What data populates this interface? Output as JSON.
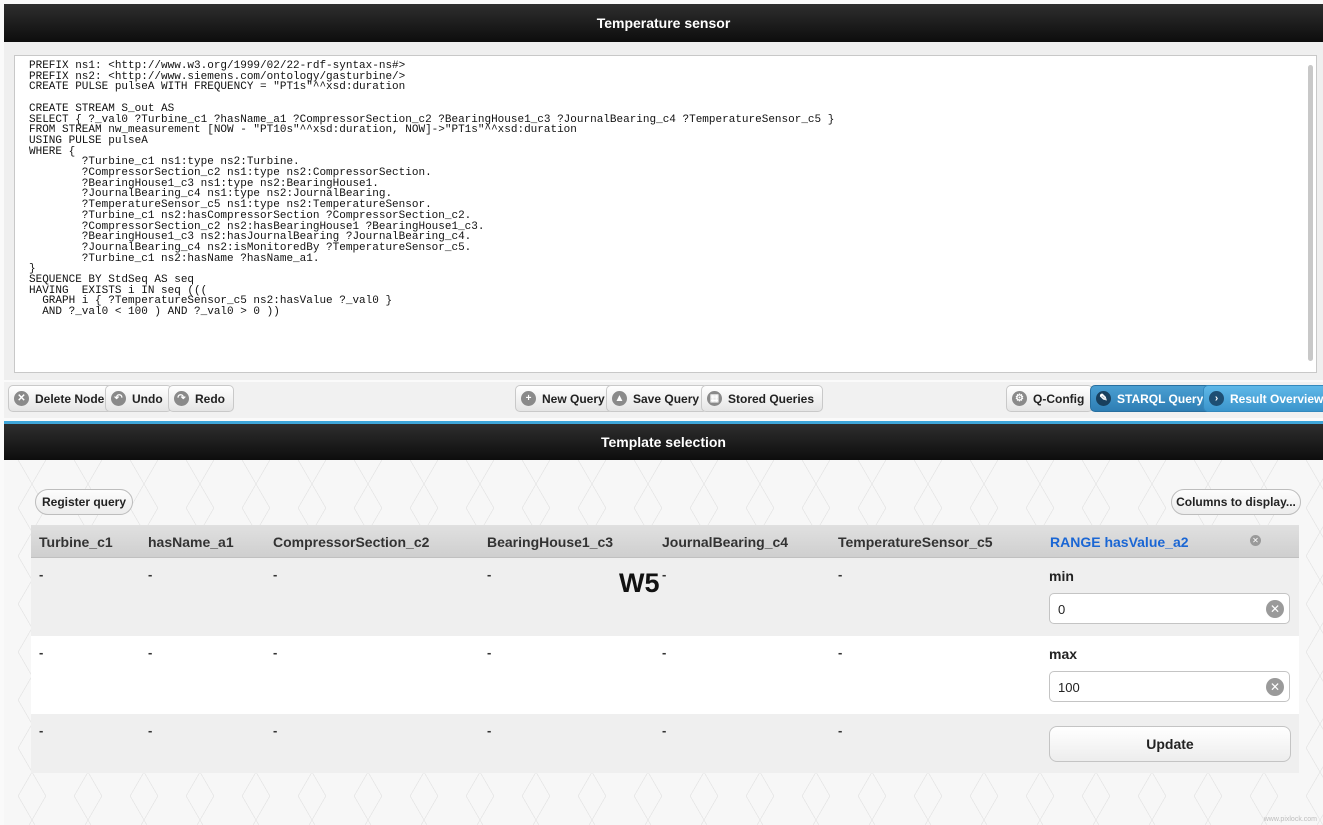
{
  "sensor_title": "Temperature sensor",
  "query_text": "PREFIX ns1: <http://www.w3.org/1999/02/22-rdf-syntax-ns#>\nPREFIX ns2: <http://www.siemens.com/ontology/gasturbine/>\nCREATE PULSE pulseA WITH FREQUENCY = \"PT1s\"^^xsd:duration\n\nCREATE STREAM S_out AS\nSELECT { ?_val0 ?Turbine_c1 ?hasName_a1 ?CompressorSection_c2 ?BearingHouse1_c3 ?JournalBearing_c4 ?TemperatureSensor_c5 }\nFROM STREAM nw_measurement [NOW - \"PT10s\"^^xsd:duration, NOW]->\"PT1s\"^^xsd:duration\nUSING PULSE pulseA\nWHERE {\n        ?Turbine_c1 ns1:type ns2:Turbine.\n        ?CompressorSection_c2 ns1:type ns2:CompressorSection.\n        ?BearingHouse1_c3 ns1:type ns2:BearingHouse1.\n        ?JournalBearing_c4 ns1:type ns2:JournalBearing.\n        ?TemperatureSensor_c5 ns1:type ns2:TemperatureSensor.\n        ?Turbine_c1 ns2:hasCompressorSection ?CompressorSection_c2.\n        ?CompressorSection_c2 ns2:hasBearingHouse1 ?BearingHouse1_c3.\n        ?BearingHouse1_c3 ns2:hasJournalBearing ?JournalBearing_c4.\n        ?JournalBearing_c4 ns2:isMonitoredBy ?TemperatureSensor_c5.\n        ?Turbine_c1 ns2:hasName ?hasName_a1.\n}\nSEQUENCE BY StdSeq AS seq\nHAVING  EXISTS i IN seq (((\n  GRAPH i { ?TemperatureSensor_c5 ns2:hasValue ?_val0 }\n  AND ?_val0 < 100 ) AND ?_val0 > 0 ))",
  "toolbar": {
    "delete_node": "Delete Node",
    "undo": "Undo",
    "redo": "Redo",
    "new_query": "New Query",
    "save_query": "Save Query",
    "stored_queries": "Stored Queries",
    "q_config": "Q-Config",
    "starql_query": "STARQL Query",
    "result_overview": "Result Overview"
  },
  "template_title": "Template selection",
  "register_query": "Register query",
  "columns_to_display": "Columns to display...",
  "columns": [
    "Turbine_c1",
    "hasName_a1",
    "CompressorSection_c2",
    "BearingHouse1_c3",
    "JournalBearing_c4",
    "TemperatureSensor_c5",
    "RANGE hasValue_a2"
  ],
  "rows": [
    [
      "-",
      "-",
      "-",
      "-",
      "-",
      "-"
    ],
    [
      "-",
      "-",
      "-",
      "-",
      "-",
      "-"
    ],
    [
      "-",
      "-",
      "-",
      "-",
      "-",
      "-"
    ]
  ],
  "range": {
    "min_label": "min",
    "min_value": "0",
    "max_label": "max",
    "max_value": "100",
    "update_label": "Update"
  },
  "overlay_label": "W5",
  "watermark": "www.pixlock.com"
}
